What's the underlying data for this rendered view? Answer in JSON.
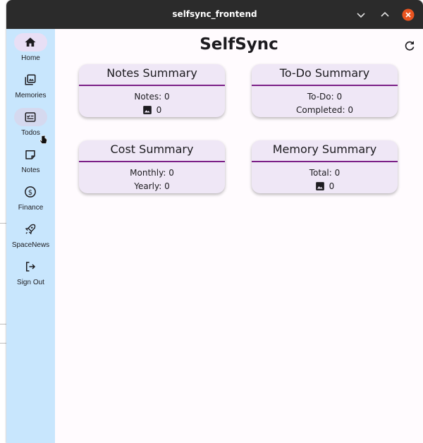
{
  "window": {
    "title": "selfsync_frontend",
    "controls": [
      "chevron-down",
      "chevron-up",
      "close"
    ]
  },
  "sidebar": {
    "background": "#c8e6fd",
    "items": [
      {
        "label": "Home",
        "icon": "home-icon",
        "active": true
      },
      {
        "label": "Memories",
        "icon": "photo-library-icon"
      },
      {
        "label": "Todos",
        "icon": "checklist-icon",
        "hovered": true
      },
      {
        "label": "Notes",
        "icon": "note-icon"
      },
      {
        "label": "Finance",
        "icon": "dollar-circle-icon"
      },
      {
        "label": "SpaceNews",
        "icon": "rocket-icon"
      },
      {
        "label": "Sign Out",
        "icon": "logout-icon"
      }
    ]
  },
  "main": {
    "title": "SelfSync",
    "accent": "#7b1f86",
    "cards": [
      {
        "title": "Notes Summary",
        "line1": "Notes: 0",
        "line2_icon": "image-icon",
        "line2": "0"
      },
      {
        "title": "To-Do Summary",
        "line1": "To-Do: 0",
        "line2": "Completed: 0"
      },
      {
        "title": "Cost Summary",
        "line1": "Monthly: 0",
        "line2": "Yearly: 0"
      },
      {
        "title": "Memory Summary",
        "line1": "Total: 0",
        "line2_icon": "image-icon",
        "line2": "0"
      }
    ]
  }
}
